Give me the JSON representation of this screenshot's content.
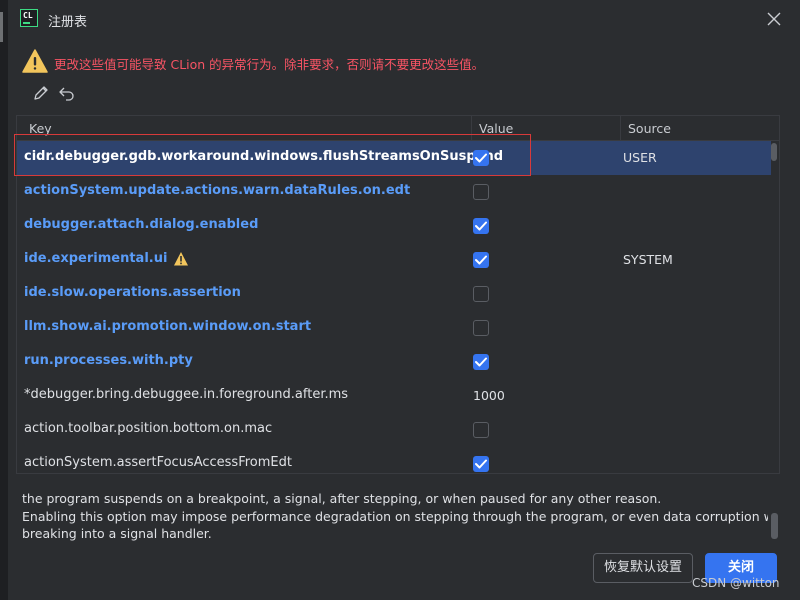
{
  "window": {
    "title": "注册表",
    "app_icon_text": "CL"
  },
  "warning": "更改这些值可能导致 CLion 的异常行为。除非要求，否则请不要更改这些值。",
  "toolbar": {
    "edit_icon": "pencil-icon",
    "revert_icon": "undo-icon"
  },
  "table": {
    "columns": [
      "Key",
      "Value",
      "Source"
    ],
    "rows": [
      {
        "key": "cidr.debugger.gdb.workaround.windows.flushStreamsOnSuspend",
        "value": true,
        "source": "USER",
        "style": "selected"
      },
      {
        "key": "actionSystem.update.actions.warn.dataRules.on.edt",
        "value": false,
        "source": "",
        "style": "modified"
      },
      {
        "key": "debugger.attach.dialog.enabled",
        "value": true,
        "source": "",
        "style": "modified"
      },
      {
        "key": "ide.experimental.ui",
        "value": true,
        "source": "SYSTEM",
        "style": "modified",
        "warning_icon": true
      },
      {
        "key": "ide.slow.operations.assertion",
        "value": false,
        "source": "",
        "style": "modified"
      },
      {
        "key": "llm.show.ai.promotion.window.on.start",
        "value": false,
        "source": "",
        "style": "modified"
      },
      {
        "key": "run.processes.with.pty",
        "value": true,
        "source": "",
        "style": "modified"
      },
      {
        "key": "*debugger.bring.debuggee.in.foreground.after.ms",
        "value": "1000",
        "source": "",
        "style": "default"
      },
      {
        "key": "action.toolbar.position.bottom.on.mac",
        "value": false,
        "source": "",
        "style": "default"
      },
      {
        "key": "actionSystem.assertFocusAccessFromEdt",
        "value": true,
        "source": "",
        "style": "default"
      }
    ]
  },
  "description": {
    "line1": "the program suspends on a breakpoint, a signal, after stepping, or when paused for any other reason.",
    "line2": " Enabling this option may impose performance degradation on stepping through the program, or even data corruption when",
    "line3": "breaking into a signal handler."
  },
  "buttons": {
    "reset": "恢复默认设置",
    "close": "关闭"
  },
  "watermark": "CSDN @witton",
  "colors": {
    "background": "#2b2d30",
    "modified_key": "#5a9cf8",
    "warning_text": "#f75464",
    "accent": "#3574f0",
    "selection": "#2e436e",
    "highlight_box": "#d83a3a"
  }
}
